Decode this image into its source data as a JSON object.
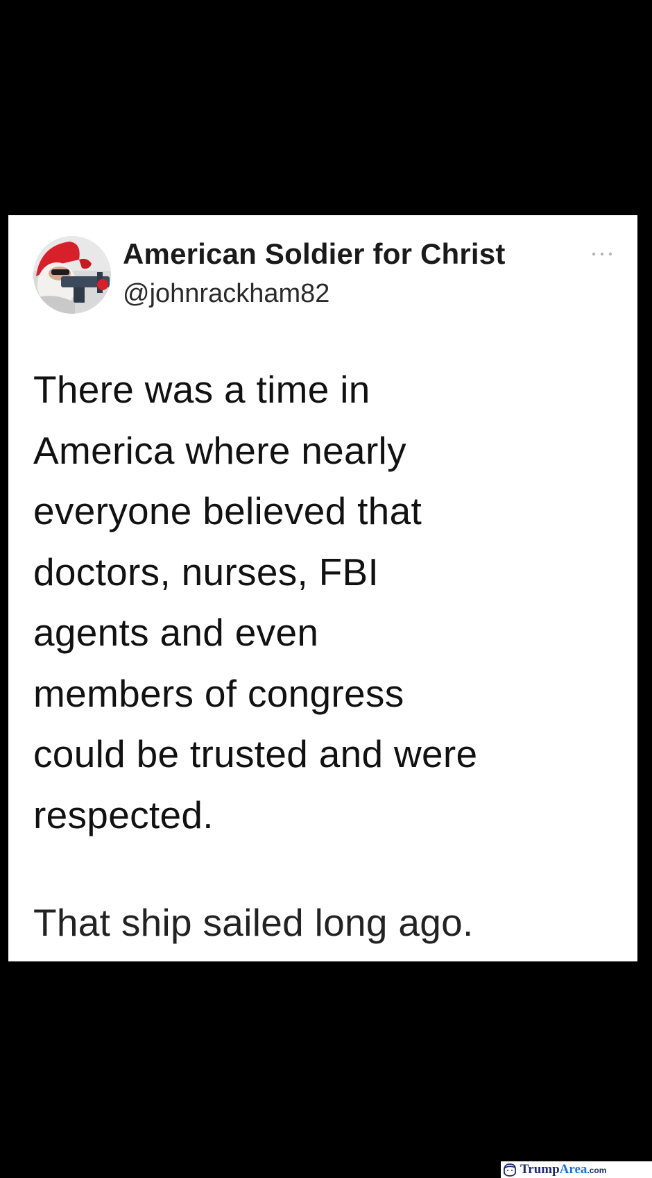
{
  "tweet": {
    "display_name": "American Soldier for Christ",
    "handle": "@johnrackham82",
    "body": "There was a time in\nAmerica where nearly\neveryone believed that\ndoctors, nurses, FBI\nagents and even\nmembers of congress\ncould be trusted and were\nrespected.",
    "followup": "That ship sailed long ago.",
    "avatar_icon": "santa-profile-avatar",
    "more_icon": "more-options-dots-icon"
  },
  "watermark": {
    "brand_part1": "Trump",
    "brand_part2": "Area",
    "brand_tld": ".com",
    "logo_icon": "trump-head-logo-icon"
  },
  "colors": {
    "background": "#000000",
    "card": "#ffffff",
    "text": "#111111",
    "watermark_dark": "#1c2b6e",
    "watermark_blue": "#1f6fd1"
  }
}
